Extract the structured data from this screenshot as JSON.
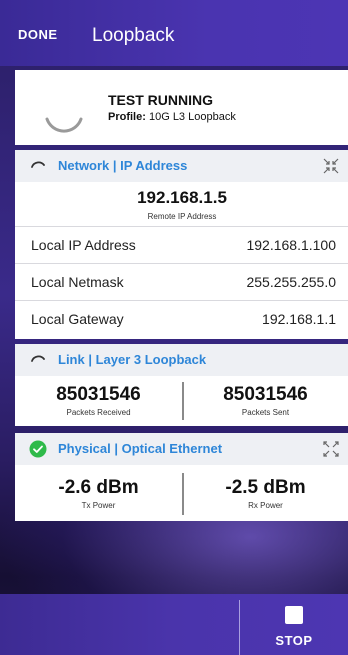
{
  "header": {
    "done_label": "DONE",
    "title": "Loopback"
  },
  "status": {
    "title": "TEST RUNNING",
    "profile_label": "Profile:",
    "profile_value": "10G L3 Loopback"
  },
  "network": {
    "header": "Network | IP Address",
    "remote_ip": "192.168.1.5",
    "remote_ip_caption": "Remote IP Address",
    "rows": [
      {
        "label": "Local IP Address",
        "value": "192.168.1.100"
      },
      {
        "label": "Local Netmask",
        "value": "255.255.255.0"
      },
      {
        "label": "Local Gateway",
        "value": "192.168.1.1"
      }
    ]
  },
  "link": {
    "header": "Link | Layer 3 Loopback",
    "received_value": "85031546",
    "received_caption": "Packets Received",
    "sent_value": "85031546",
    "sent_caption": "Packets Sent"
  },
  "physical": {
    "header": "Physical | Optical Ethernet",
    "tx_value": "-2.6 dBm",
    "tx_caption": "Tx Power",
    "rx_value": "-2.5 dBm",
    "rx_caption": "Rx Power"
  },
  "footer": {
    "stop_label": "STOP"
  },
  "colors": {
    "accent_blue": "#2e86d8",
    "status_green": "#2fba4a",
    "header_purple": "#4a34b0"
  },
  "icons": {
    "status_spinner": "spinner-icon",
    "network_status": "spinner-icon",
    "network_corner": "collapse-icon",
    "link_status": "spinner-icon",
    "physical_status": "check-circle-icon",
    "physical_corner": "expand-icon",
    "stop": "stop-icon"
  }
}
